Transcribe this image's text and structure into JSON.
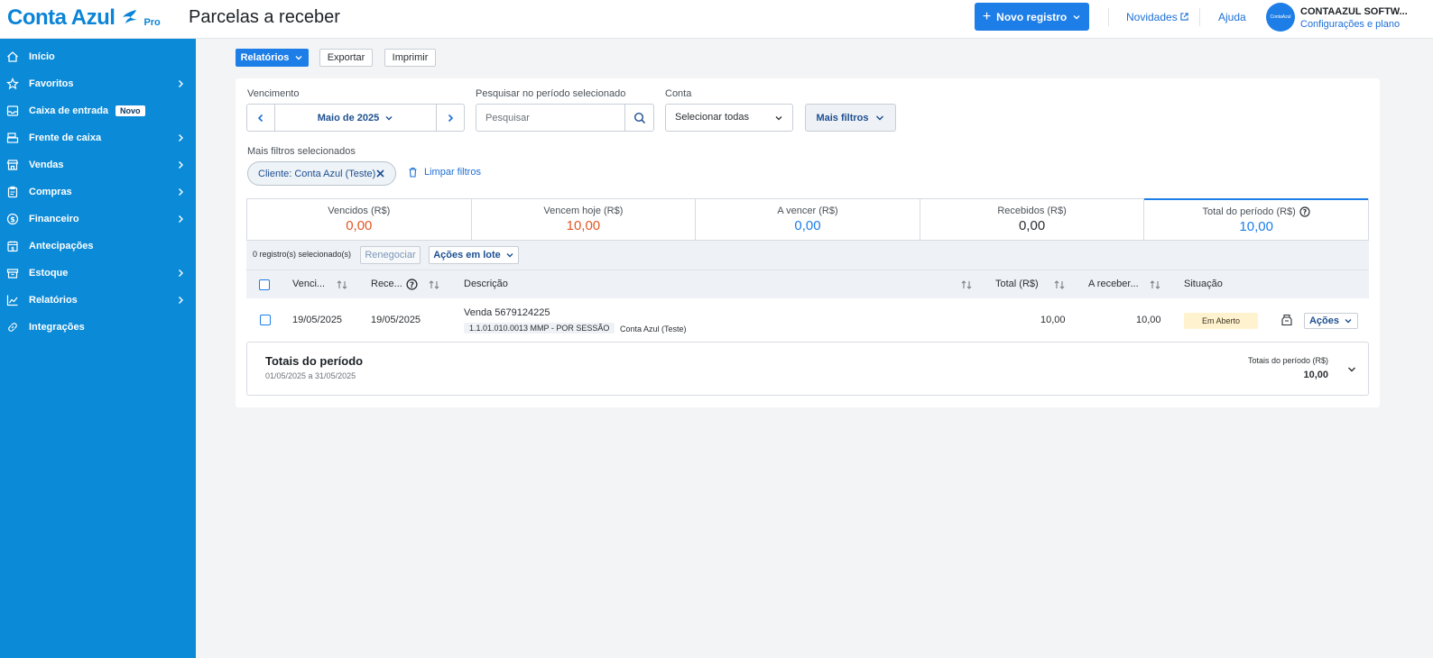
{
  "header": {
    "logo_text": "Conta Azul",
    "logo_badge": "Pro",
    "page_title": "Parcelas a receber",
    "new_record_label": "Novo registro",
    "novidades_label": "Novidades",
    "ajuda_label": "Ajuda",
    "avatar_text": "ContaAzul",
    "company_name": "CONTAAZUL SOFTW...",
    "company_sub": "Configurações e plano"
  },
  "sidebar": {
    "items": [
      {
        "label": "Início",
        "icon": "home-icon"
      },
      {
        "label": "Favoritos",
        "icon": "star-icon"
      },
      {
        "label": "Caixa de entrada",
        "icon": "inbox-icon",
        "badge": "Novo"
      },
      {
        "label": "Frente de caixa",
        "icon": "register-icon"
      },
      {
        "label": "Vendas",
        "icon": "store-icon"
      },
      {
        "label": "Compras",
        "icon": "clipboard-icon"
      },
      {
        "label": "Financeiro",
        "icon": "dollar-icon"
      },
      {
        "label": "Antecipações",
        "icon": "calendar-money-icon"
      },
      {
        "label": "Estoque",
        "icon": "box-icon"
      },
      {
        "label": "Relatórios",
        "icon": "chart-icon"
      },
      {
        "label": "Integrações",
        "icon": "link-icon"
      }
    ]
  },
  "actions": {
    "relatorios": "Relatórios",
    "exportar": "Exportar",
    "imprimir": "Imprimir"
  },
  "filters": {
    "vencimento_label": "Vencimento",
    "period_value": "Maio de 2025",
    "search_label": "Pesquisar no período selecionado",
    "search_placeholder": "Pesquisar",
    "conta_label": "Conta",
    "conta_value": "Selecionar todas",
    "mais_filtros": "Mais filtros",
    "selected_label": "Mais filtros selecionados",
    "chip": "Cliente: Conta Azul (Teste)",
    "limpar": "Limpar filtros"
  },
  "totals": [
    {
      "label": "Vencidos (R$)",
      "value": "0,00",
      "color": "#e25726"
    },
    {
      "label": "Vencem hoje (R$)",
      "value": "10,00",
      "color": "#e25726"
    },
    {
      "label": "A vencer (R$)",
      "value": "0,00",
      "color": "#1d7ee8"
    },
    {
      "label": "Recebidos (R$)",
      "value": "0,00",
      "color": "#2b2f33"
    },
    {
      "label": "Total do período (R$)",
      "value": "10,00",
      "color": "#1d7ee8"
    }
  ],
  "table": {
    "selected_count": "0 registro(s) selecionado(s)",
    "renegociar": "Renegociar",
    "acoes_lote": "Ações em lote",
    "headers": {
      "vencimento": "Venci...",
      "recebimento": "Rece...",
      "descricao": "Descrição",
      "total": "Total (R$)",
      "a_receber": "A receber...",
      "situacao": "Situação"
    },
    "rows": [
      {
        "vencimento": "19/05/2025",
        "recebimento": "19/05/2025",
        "descricao": "Venda 5679124225",
        "codigo": "1.1.01.010.0013 MMP - POR SESSÃO",
        "cliente": "Conta Azul (Teste)",
        "total": "10,00",
        "a_receber": "10,00",
        "situacao": "Em Aberto",
        "acoes": "Ações"
      }
    ]
  },
  "periodo": {
    "title": "Totais do período",
    "range": "01/05/2025 a 31/05/2025",
    "right_label": "Totais do período (R$)",
    "right_value": "10,00"
  }
}
